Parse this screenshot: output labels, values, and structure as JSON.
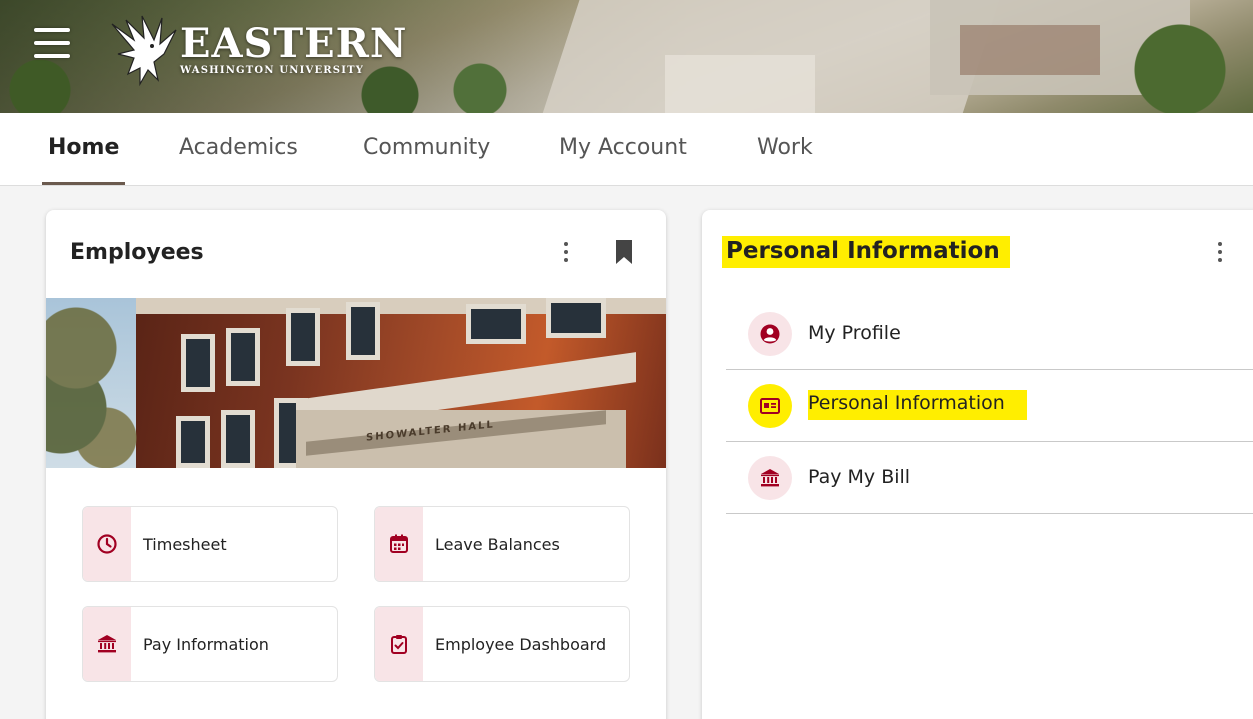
{
  "header": {
    "logo_name": "EASTERN",
    "logo_subtitle": "WASHINGTON UNIVERSITY"
  },
  "tabs": [
    {
      "label": "Home",
      "active": true
    },
    {
      "label": "Academics"
    },
    {
      "label": "Community"
    },
    {
      "label": "My Account"
    },
    {
      "label": "Work"
    }
  ],
  "employees_card": {
    "title": "Employees",
    "building_sign": "SHOWALTER HALL",
    "tiles": [
      {
        "label": "Timesheet",
        "icon": "clock-icon"
      },
      {
        "label": "Leave Balances",
        "icon": "calendar-icon"
      },
      {
        "label": "Pay Information",
        "icon": "bank-icon"
      },
      {
        "label": "Employee Dashboard",
        "icon": "clipboard-check-icon"
      }
    ]
  },
  "personal_card": {
    "title": "Personal Information",
    "items": [
      {
        "label": "My Profile",
        "icon": "user-circle-icon"
      },
      {
        "label": "Personal Information",
        "icon": "id-card-icon",
        "highlighted": true
      },
      {
        "label": "Pay My Bill",
        "icon": "bank-icon"
      }
    ]
  },
  "colors": {
    "accent": "#a10022",
    "icon_bg": "#f8e4e7",
    "highlight": "#ffee00",
    "tab_underline": "#6b5a4e"
  }
}
